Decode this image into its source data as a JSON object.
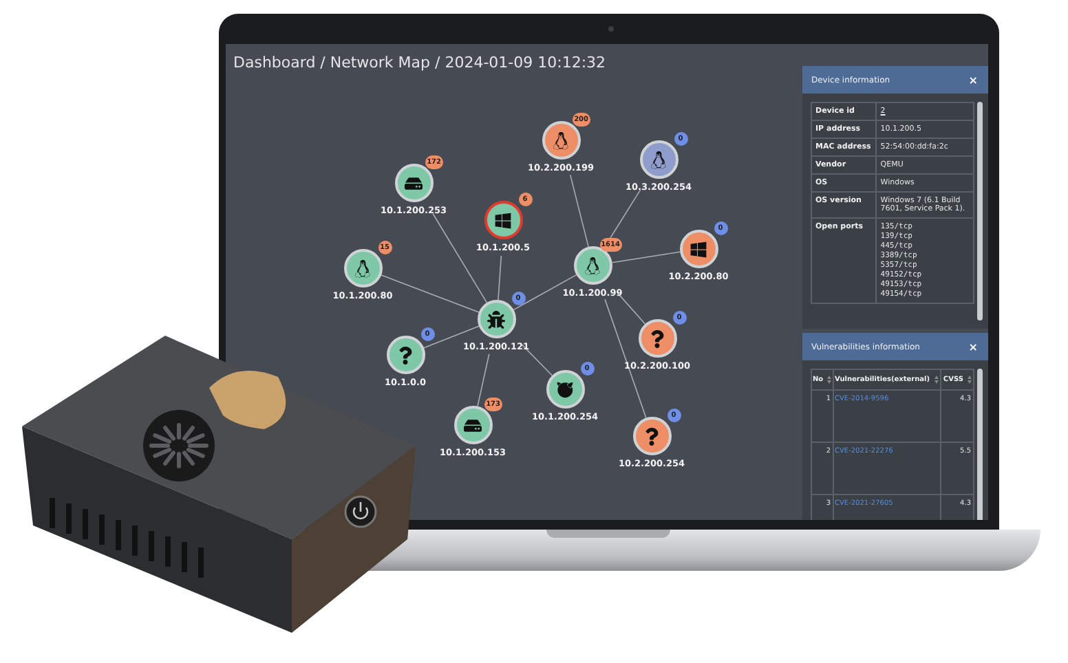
{
  "map": {
    "title": "Dashboard / Network Map / 2024-01-09 10:12:32",
    "nodes": [
      {
        "label": "10.2.200.199",
        "kind": "linux",
        "color": "#ee8e66",
        "badge": "200",
        "badge_alert": true,
        "alert": false
      },
      {
        "label": "10.3.200.254",
        "kind": "linux",
        "color": "#8e9dcc",
        "badge": "0",
        "badge_alert": false,
        "alert": false
      },
      {
        "label": "10.1.200.253",
        "kind": "drive",
        "color": "#7ec8a8",
        "badge": "172",
        "badge_alert": true,
        "alert": false
      },
      {
        "label": "10.1.200.5",
        "kind": "windows",
        "color": "#7ec8a8",
        "badge": "6",
        "badge_alert": true,
        "alert": true
      },
      {
        "label": "10.2.200.80",
        "kind": "windows",
        "color": "#ee8e66",
        "badge": "0",
        "badge_alert": false,
        "alert": false
      },
      {
        "label": "10.1.200.80",
        "kind": "linux",
        "color": "#7ec8a8",
        "badge": "15",
        "badge_alert": true,
        "alert": false
      },
      {
        "label": "10.1.200.99",
        "kind": "linux",
        "color": "#7ec8a8",
        "badge": "1614",
        "badge_alert": true,
        "alert": false
      },
      {
        "label": "10.1.200.121",
        "kind": "bug",
        "color": "#7ec8a8",
        "badge": "0",
        "badge_alert": false,
        "alert": false
      },
      {
        "label": "10.1.0.0",
        "kind": "unknown",
        "color": "#7ec8a8",
        "badge": "0",
        "badge_alert": false,
        "alert": false
      },
      {
        "label": "10.2.200.100",
        "kind": "unknown",
        "color": "#ee8e66",
        "badge": "0",
        "badge_alert": false,
        "alert": false
      },
      {
        "label": "10.1.200.254",
        "kind": "bsd",
        "color": "#7ec8a8",
        "badge": "0",
        "badge_alert": false,
        "alert": false
      },
      {
        "label": "10.1.200.153",
        "kind": "drive",
        "color": "#7ec8a8",
        "badge": "173",
        "badge_alert": true,
        "alert": false
      },
      {
        "label": "10.2.200.254",
        "kind": "unknown",
        "color": "#ee8e66",
        "badge": "0",
        "badge_alert": false,
        "alert": false
      }
    ]
  },
  "device_panel": {
    "title": "Device information",
    "close": "×",
    "rows": [
      {
        "key": "Device id",
        "value": "2",
        "kind": "link"
      },
      {
        "key": "IP address",
        "value": "10.1.200.5",
        "kind": "text"
      },
      {
        "key": "MAC address",
        "value": "52:54:00:dd:fa:2c",
        "kind": "text"
      },
      {
        "key": "Vendor",
        "value": "QEMU",
        "kind": "text"
      },
      {
        "key": "OS",
        "value": "Windows",
        "kind": "text"
      },
      {
        "key": "OS version",
        "value": "Windows 7 (6.1 Build 7601, Service Pack 1).",
        "kind": "text"
      },
      {
        "key": "Open ports",
        "values": [
          "135/tcp",
          "139/tcp",
          "445/tcp",
          "3389/tcp",
          "5357/tcp",
          "49152/tcp",
          "49153/tcp",
          "49154/tcp"
        ],
        "kind": "list"
      }
    ]
  },
  "vuln_panel": {
    "title": "Vulnerabilities information",
    "close": "×",
    "columns": [
      "No",
      "Vulnerabilities(external)",
      "CVSS"
    ],
    "rows": [
      {
        "no": "1",
        "cve": "CVE-2014-9596",
        "cvss": "4.3"
      },
      {
        "no": "2",
        "cve": "CVE-2021-22276",
        "cvss": "5.5"
      },
      {
        "no": "3",
        "cve": "CVE-2021-27605",
        "cvss": "4.3"
      }
    ]
  }
}
